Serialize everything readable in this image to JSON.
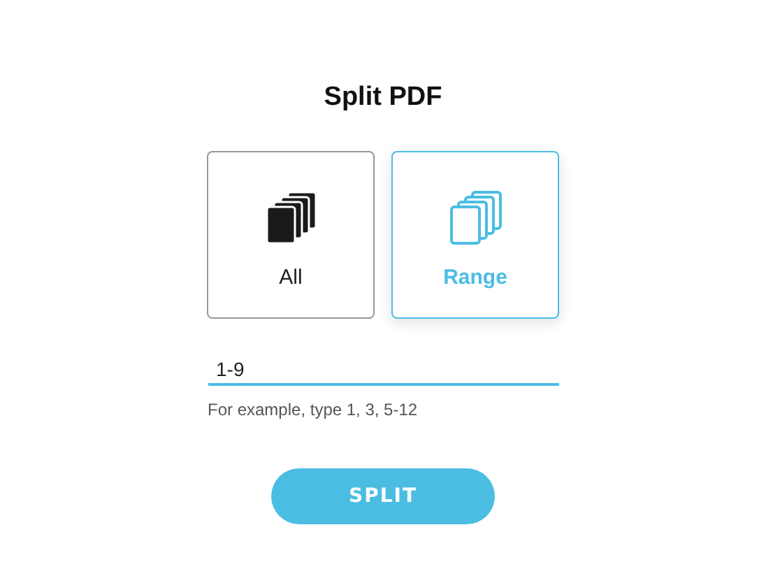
{
  "title": "Split PDF",
  "options": [
    {
      "label": "All",
      "selected": false
    },
    {
      "label": "Range",
      "selected": true
    }
  ],
  "range_field": {
    "value": "1-9"
  },
  "hint": "For example, type 1, 3, 5-12",
  "button": "SPLIT"
}
